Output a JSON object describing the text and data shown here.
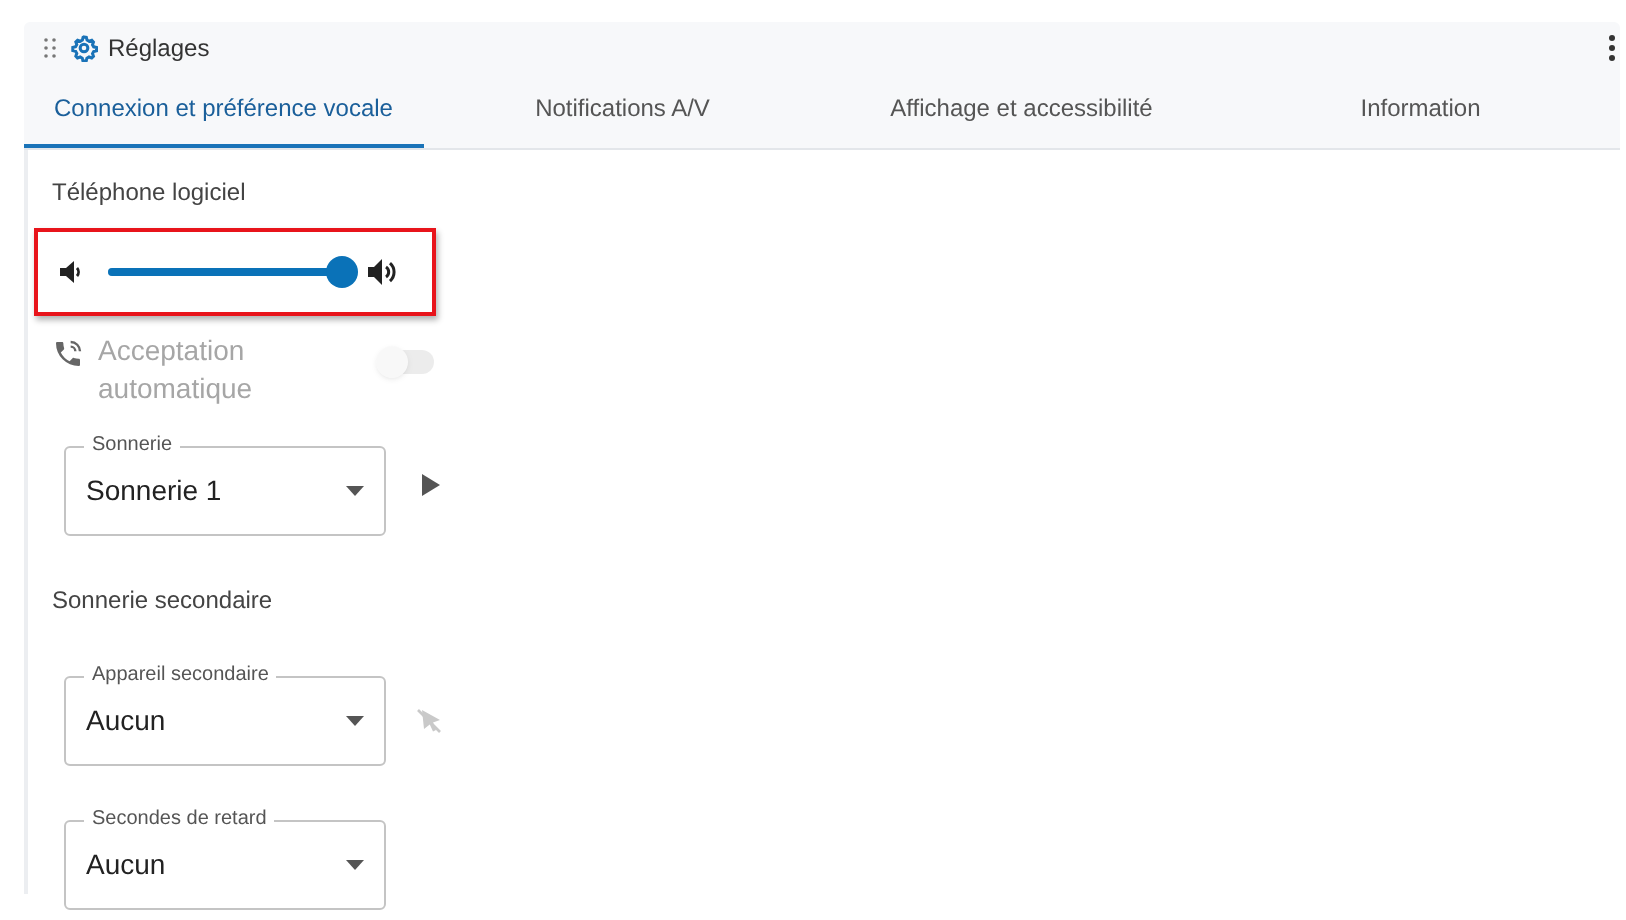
{
  "header": {
    "title": "Réglages"
  },
  "tabs": [
    {
      "label": "Connexion et préférence vocale",
      "selected": true
    },
    {
      "label": "Notifications A/V",
      "selected": false
    },
    {
      "label": "Affichage et accessibilité",
      "selected": false
    },
    {
      "label": "Information",
      "selected": false
    }
  ],
  "softphone": {
    "heading": "Téléphone logiciel",
    "volume": {
      "level": 1.0,
      "highlighted": true
    }
  },
  "auto_answer": {
    "label": "Acceptation automatique",
    "on": false,
    "disabled": true
  },
  "ringtone": {
    "legend": "Sonnerie",
    "value": "Sonnerie 1",
    "kind": "playable"
  },
  "secondary": {
    "heading": "Sonnerie secondaire",
    "selects": [
      {
        "legend": "Appareil secondaire",
        "value": "Aucun",
        "kind": "pointer-off"
      },
      {
        "legend": "Secondes de retard",
        "value": "Aucun",
        "kind": "plain"
      }
    ]
  }
}
